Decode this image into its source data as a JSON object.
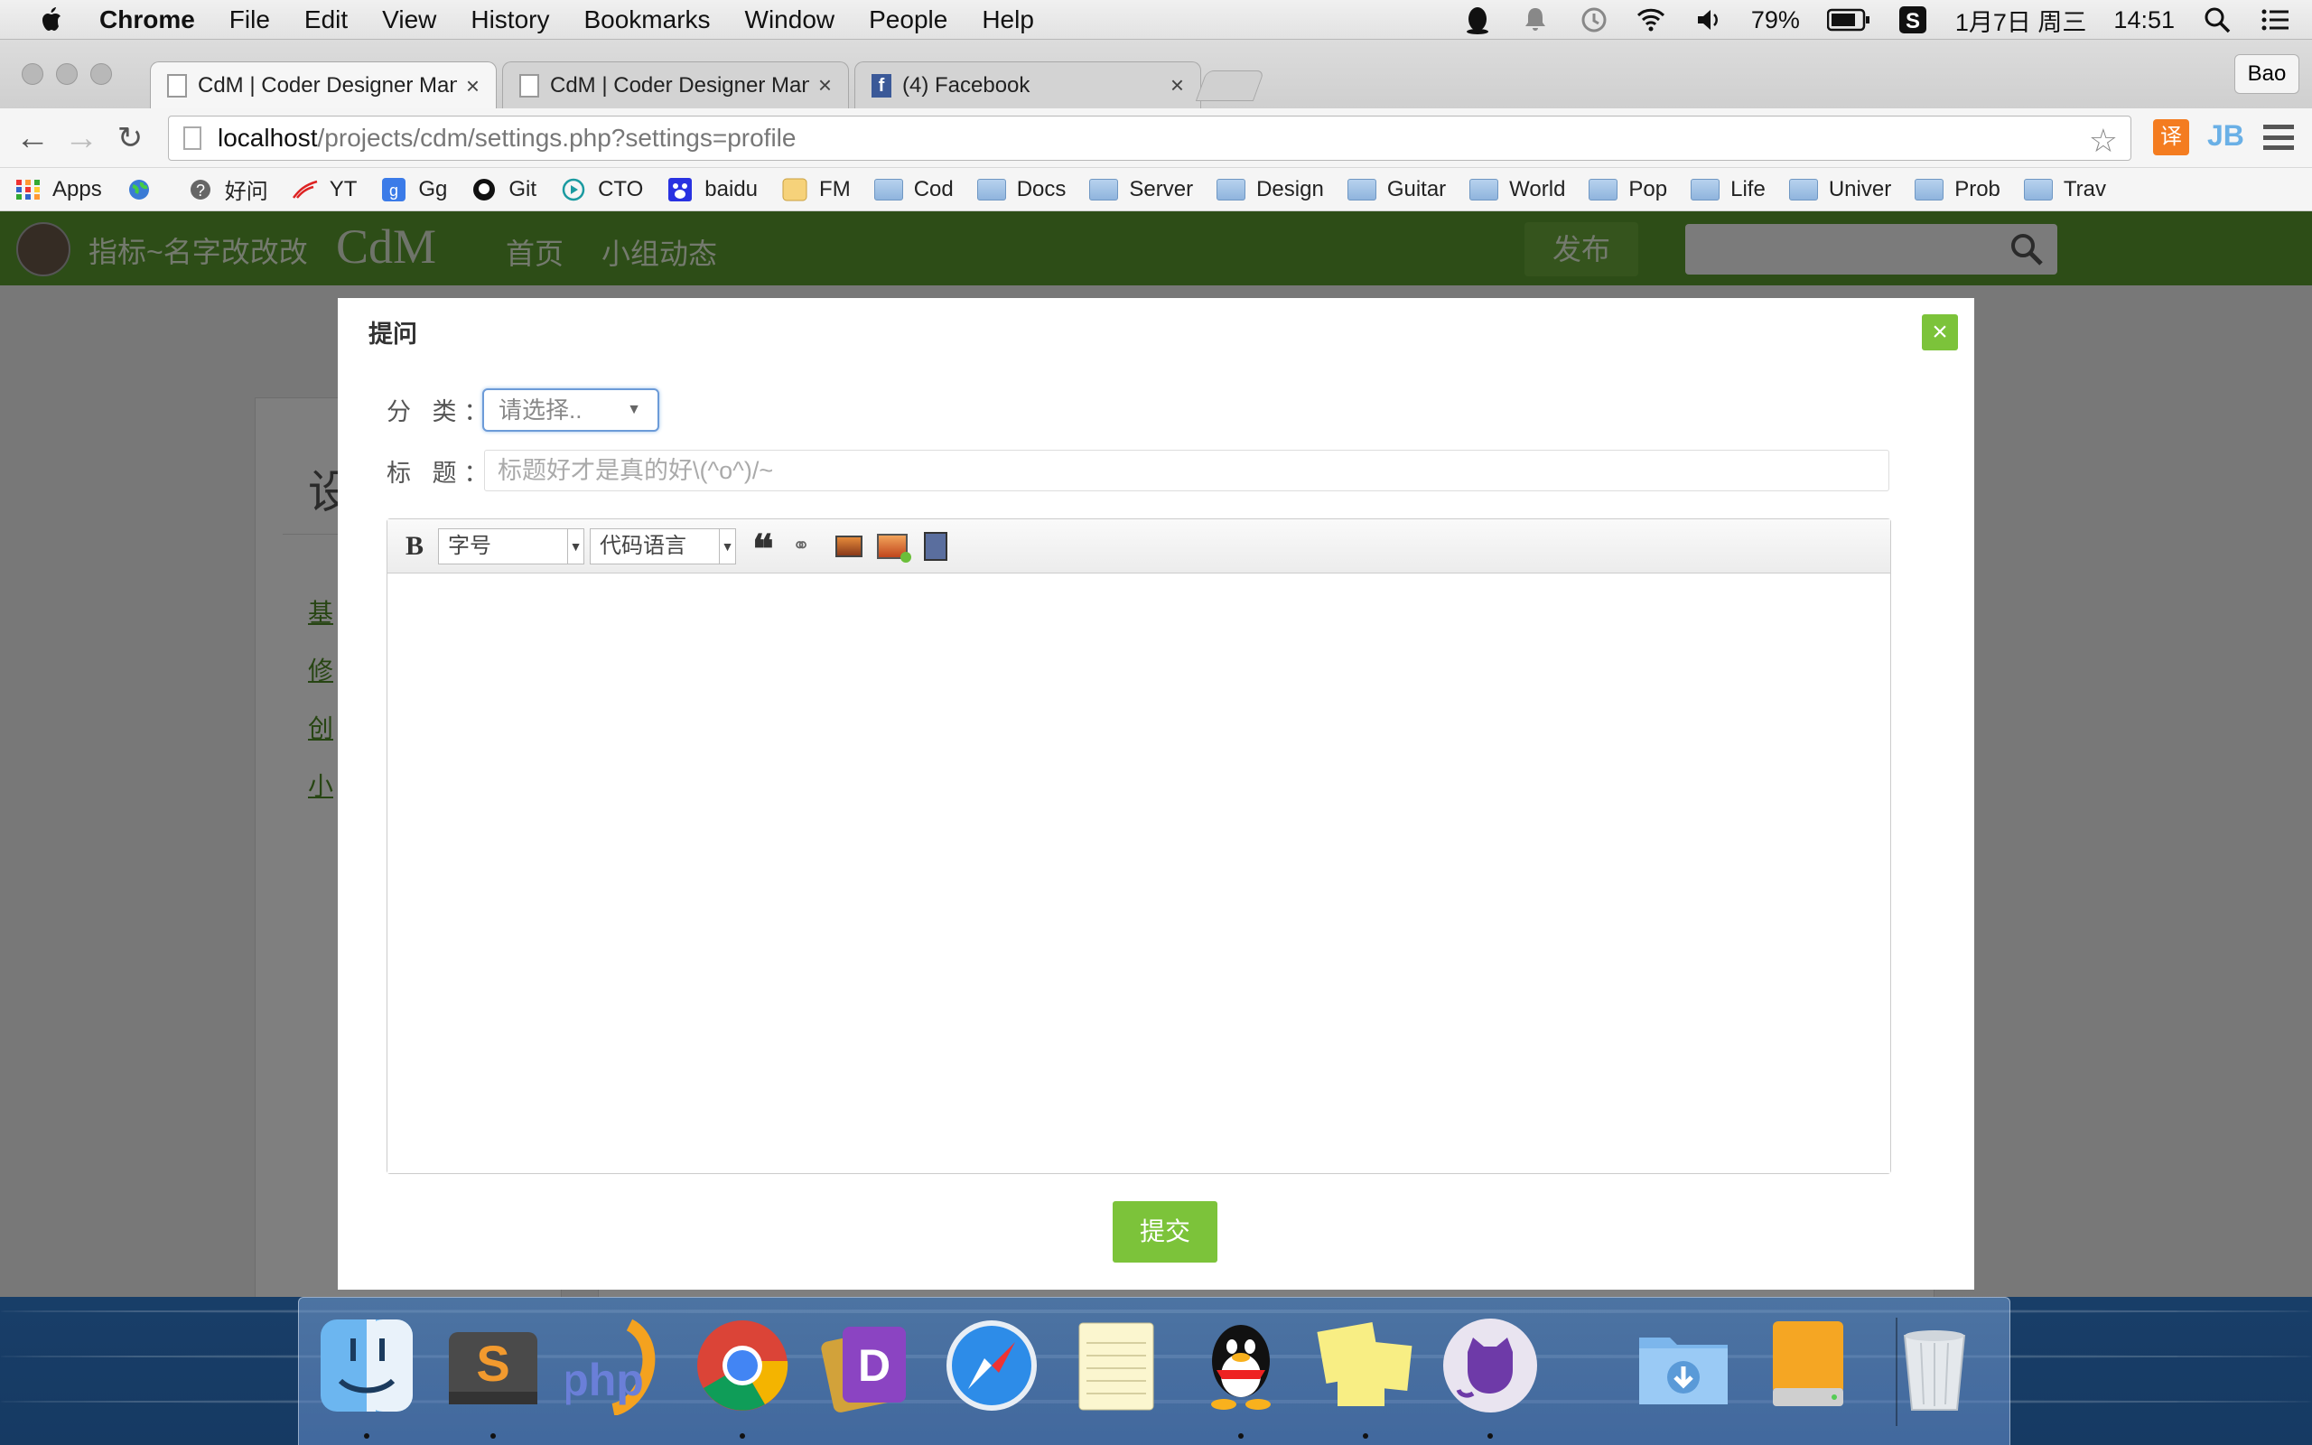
{
  "menubar": {
    "app_name": "Chrome",
    "items": [
      "File",
      "Edit",
      "View",
      "History",
      "Bookmarks",
      "Window",
      "People",
      "Help"
    ],
    "battery": "79%",
    "date": "1月7日 周三",
    "time": "14:51",
    "status_icons": [
      "qq-icon",
      "notification-icon",
      "time-machine-icon",
      "wifi-icon",
      "volume-icon",
      "battery-icon",
      "sogou-icon",
      "spotlight-icon",
      "notification-center-icon"
    ]
  },
  "browser": {
    "tabs": [
      {
        "title": "CdM | Coder Designer Man",
        "favicon": "page-icon",
        "active": true
      },
      {
        "title": "CdM | Coder Designer Man",
        "favicon": "page-icon",
        "active": false
      },
      {
        "title": "(4) Facebook",
        "favicon": "facebook-icon",
        "active": false
      }
    ],
    "tab_close": "×",
    "profile": "Bao",
    "url_host": "localhost",
    "url_path": "/projects/cdm/settings.php?settings=profile",
    "ext_translate": "译",
    "ext_jb": "JB"
  },
  "bookmarks": [
    {
      "label": "Apps",
      "icon": "apps-grid-icon"
    },
    {
      "label": "",
      "icon": "globe-icon"
    },
    {
      "label": "好问",
      "icon": "question-icon"
    },
    {
      "label": "YT",
      "icon": "yt-icon"
    },
    {
      "label": "Gg",
      "icon": "google-icon"
    },
    {
      "label": "Git",
      "icon": "github-icon"
    },
    {
      "label": "CTO",
      "icon": "cto-icon"
    },
    {
      "label": "baidu",
      "icon": "baidu-paw-icon"
    },
    {
      "label": "FM",
      "icon": "fm-icon"
    },
    {
      "label": "Cod",
      "icon": "folder-icon"
    },
    {
      "label": "Docs",
      "icon": "folder-icon"
    },
    {
      "label": "Server",
      "icon": "folder-icon"
    },
    {
      "label": "Design",
      "icon": "folder-icon"
    },
    {
      "label": "Guitar",
      "icon": "folder-icon"
    },
    {
      "label": "World",
      "icon": "folder-icon"
    },
    {
      "label": "Pop",
      "icon": "folder-icon"
    },
    {
      "label": "Life",
      "icon": "folder-icon"
    },
    {
      "label": "Univer",
      "icon": "folder-icon"
    },
    {
      "label": "Prob",
      "icon": "folder-icon"
    },
    {
      "label": "Trav",
      "icon": "folder-icon"
    }
  ],
  "site": {
    "username": "指标~名字改改改",
    "logo": "CdM",
    "nav": [
      "首页",
      "小组动态"
    ],
    "publish": "发布",
    "bg_title": "设",
    "bg_links": [
      "基",
      "修",
      "创",
      "小"
    ]
  },
  "modal": {
    "title": "提问",
    "category_label": "分 类：",
    "category_placeholder": "请选择..",
    "title_label": "标 题：",
    "title_placeholder": "标题好才是真的好\\(^o^)/~",
    "font_size": "字号",
    "code_lang": "代码语言",
    "submit": "提交",
    "close": "×"
  },
  "dock": [
    {
      "name": "finder",
      "running": true
    },
    {
      "name": "sublime-text",
      "running": true
    },
    {
      "name": "phpstorm",
      "running": false
    },
    {
      "name": "chrome",
      "running": true
    },
    {
      "name": "dash",
      "running": false
    },
    {
      "name": "safari",
      "running": false
    },
    {
      "name": "notes",
      "running": false
    },
    {
      "name": "qq",
      "running": true
    },
    {
      "name": "stickies",
      "running": true
    },
    {
      "name": "github",
      "running": true
    },
    {
      "name": "downloads-folder",
      "running": false
    },
    {
      "name": "external-drive",
      "running": false
    },
    {
      "name": "trash",
      "running": false
    }
  ],
  "colors": {
    "accent_green": "#7cc33a",
    "site_nav_green": "#5b9a2e",
    "focus_blue": "#6c9bd8"
  }
}
